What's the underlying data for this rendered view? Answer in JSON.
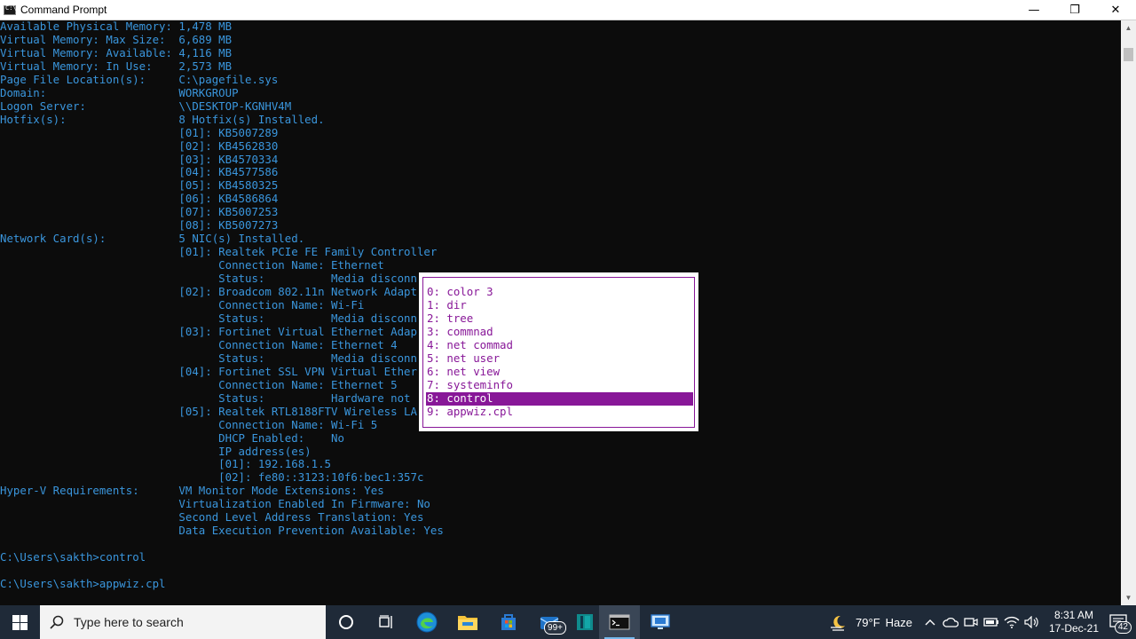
{
  "window": {
    "title": "Command Prompt",
    "minimize_glyph": "—",
    "maximize_glyph": "❐",
    "close_glyph": "✕"
  },
  "console": {
    "lines": [
      "Available Physical Memory: 1,478 MB",
      "Virtual Memory: Max Size:  6,689 MB",
      "Virtual Memory: Available: 4,116 MB",
      "Virtual Memory: In Use:    2,573 MB",
      "Page File Location(s):     C:\\pagefile.sys",
      "Domain:                    WORKGROUP",
      "Logon Server:              \\\\DESKTOP-KGNHV4M",
      "Hotfix(s):                 8 Hotfix(s) Installed.",
      "                           [01]: KB5007289",
      "                           [02]: KB4562830",
      "                           [03]: KB4570334",
      "                           [04]: KB4577586",
      "                           [05]: KB4580325",
      "                           [06]: KB4586864",
      "                           [07]: KB5007253",
      "                           [08]: KB5007273",
      "Network Card(s):           5 NIC(s) Installed.",
      "                           [01]: Realtek PCIe FE Family Controller",
      "                                 Connection Name: Ethernet",
      "                                 Status:          Media disconn",
      "                           [02]: Broadcom 802.11n Network Adapt",
      "                                 Connection Name: Wi-Fi",
      "                                 Status:          Media disconn",
      "                           [03]: Fortinet Virtual Ethernet Adap",
      "                                 Connection Name: Ethernet 4",
      "                                 Status:          Media disconn",
      "                           [04]: Fortinet SSL VPN Virtual Ether",
      "                                 Connection Name: Ethernet 5",
      "                                 Status:          Hardware not",
      "                           [05]: Realtek RTL8188FTV Wireless LA",
      "                                 Connection Name: Wi-Fi 5",
      "                                 DHCP Enabled:    No",
      "                                 IP address(es)",
      "                                 [01]: 192.168.1.5",
      "                                 [02]: fe80::3123:10f6:bec1:357c",
      "Hyper-V Requirements:      VM Monitor Mode Extensions: Yes",
      "                           Virtualization Enabled In Firmware: No",
      "                           Second Level Address Translation: Yes",
      "                           Data Execution Prevention Available: Yes",
      "",
      "C:\\Users\\sakth>control",
      "",
      "C:\\Users\\sakth>appwiz.cpl"
    ]
  },
  "history_popup": {
    "items": [
      "0: color 3",
      "1: dir",
      "2: tree",
      "3: commnad",
      "4: net commad",
      "5: net user",
      "6: net view",
      "7: systeminfo",
      "8: control",
      "9: appwiz.cpl"
    ],
    "selected_index": 8
  },
  "colors": {
    "console_text": "#3a96dd",
    "console_bg": "#0c0c0c",
    "popup_accent": "#881798",
    "taskbar_bg": "#1f2a38"
  },
  "taskbar": {
    "search_placeholder": "Type here to search",
    "apps": [
      {
        "name": "cortana-icon"
      },
      {
        "name": "task-view-icon"
      },
      {
        "name": "edge-icon"
      },
      {
        "name": "file-explorer-icon"
      },
      {
        "name": "microsoft-store-icon"
      },
      {
        "name": "outlook-mail-icon",
        "badge": "99+"
      },
      {
        "name": "teal-app-icon"
      },
      {
        "name": "command-prompt-icon",
        "active": true
      },
      {
        "name": "remote-desktop-icon"
      }
    ],
    "weather": {
      "temp": "79°F",
      "condition": "Haze"
    },
    "clock": {
      "time": "8:31 AM",
      "date": "17-Dec-21"
    },
    "notifications_count": "42"
  }
}
